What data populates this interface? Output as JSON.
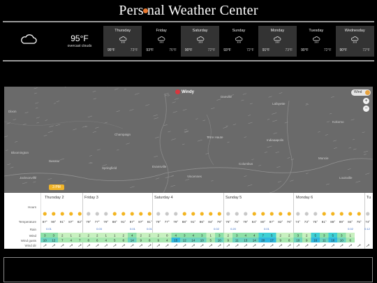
{
  "header": {
    "title_pre": "Pers",
    "title_post": "nal Weather Center"
  },
  "current": {
    "temp": "95°F",
    "description": "overcast clouds",
    "icon": "cloud-icon"
  },
  "forecast_days": [
    {
      "name": "Thursday",
      "high": "95°F",
      "low": "73°F",
      "icon": "rain-cloud-icon"
    },
    {
      "name": "Friday",
      "high": "93°F",
      "low": "76°F",
      "icon": "rain-cloud-icon"
    },
    {
      "name": "Saturday",
      "high": "90°F",
      "low": "72°F",
      "icon": "rain-cloud-icon"
    },
    {
      "name": "Sunday",
      "high": "93°F",
      "low": "72°F",
      "icon": "rain-cloud-icon"
    },
    {
      "name": "Monday",
      "high": "91°F",
      "low": "73°F",
      "icon": "rain-cloud-icon"
    },
    {
      "name": "Tuesday",
      "high": "90°F",
      "low": "72°F",
      "icon": "rain-cloud-icon"
    },
    {
      "name": "Wednesday",
      "high": "90°F",
      "low": "72°F",
      "icon": "rain-cloud-icon"
    }
  ],
  "map": {
    "brand": "Windy",
    "layer_label": "Wind",
    "zoom_in": "+",
    "zoom_out": "−",
    "time_badge": "3 PM",
    "cities": [
      "Dixon",
      "Lafayette",
      "Kokomo",
      "Indianapolis",
      "Champaign",
      "Decatur",
      "Springfield",
      "Terre Haute",
      "Bloomington",
      "Columbus",
      "Muncie",
      "Danville",
      "Jacksonville",
      "Vincennes",
      "Evansville",
      "Louisville"
    ]
  },
  "forecast_table": {
    "row_labels": [
      "Hours",
      "Temperature",
      "Rain",
      "Wind",
      "Wind gusts",
      "Wind dir"
    ],
    "days": [
      "Thursday 2",
      "Friday 3",
      "Saturday 4",
      "Sunday 5",
      "Monday 6",
      "Tu"
    ],
    "temps": [
      "87°",
      "90°",
      "91°",
      "87°",
      "82°",
      "79°",
      "77°",
      "79°",
      "88°",
      "91°",
      "87°",
      "87°",
      "81°",
      "79°",
      "77°",
      "79°",
      "88°",
      "91°",
      "86°",
      "84°",
      "79°",
      "76°",
      "76°",
      "79°",
      "84°",
      "80°",
      "87°",
      "82°",
      "76°",
      "74°",
      "73°",
      "75°",
      "81°",
      "88°",
      "89°",
      "84°",
      "75°",
      "74°"
    ],
    "rain": [
      "0.01",
      "",
      "",
      "0.03",
      "",
      "0.01",
      "0.01",
      "",
      "",
      "",
      "0.02",
      "0.20",
      "",
      "0.01",
      "",
      "",
      "",
      "",
      "0.02",
      "0.12"
    ],
    "wind": [
      "3",
      "3",
      "2",
      "1",
      "2",
      "2",
      "2",
      "1",
      "1",
      "2",
      "4",
      "2",
      "2",
      "2",
      "0",
      "4",
      "3",
      "4",
      "3",
      "1",
      "3",
      "2",
      "3",
      "4",
      "4",
      "7",
      "5",
      "2",
      "2",
      "3",
      "2",
      "5",
      "3",
      "5",
      "3",
      "1"
    ],
    "gusts": [
      "10",
      "12",
      "7",
      "4",
      "7",
      "8",
      "6",
      "4",
      "5",
      "8",
      "14",
      "9",
      "8",
      "9",
      "4",
      "15",
      "12",
      "14",
      "10",
      "5",
      "10",
      "9",
      "11",
      "13",
      "14",
      "20",
      "17",
      "9",
      "8",
      "10",
      "9",
      "16",
      "11",
      "16",
      "10",
      "6"
    ]
  }
}
